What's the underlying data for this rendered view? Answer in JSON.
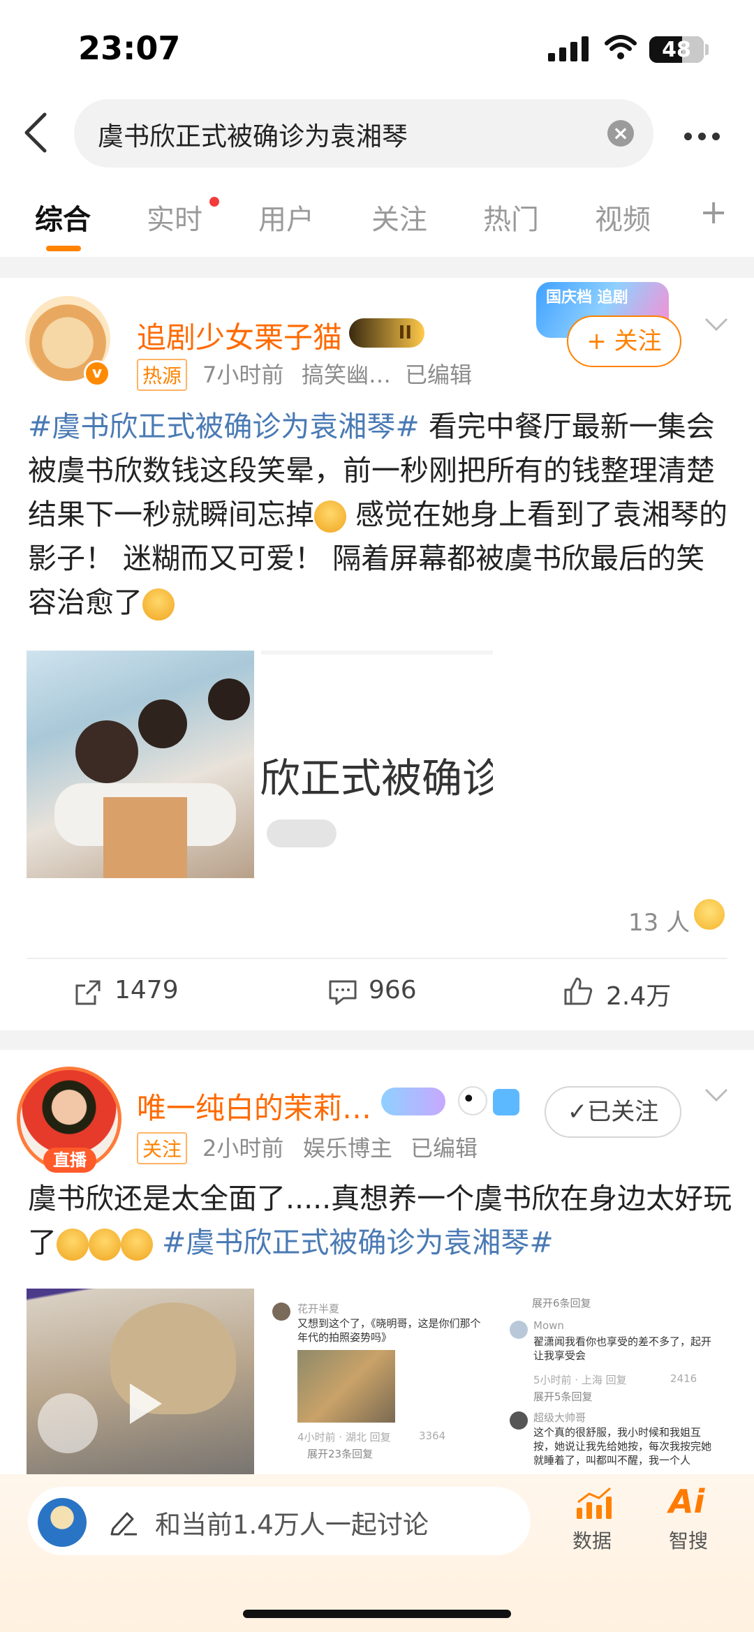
{
  "status": {
    "time": "23:07",
    "battery": "48"
  },
  "search": {
    "query": "虞书欣正式被确诊为袁湘琴"
  },
  "tabs": [
    {
      "label": "综合"
    },
    {
      "label": "实时"
    },
    {
      "label": "用户"
    },
    {
      "label": "关注"
    },
    {
      "label": "热门"
    },
    {
      "label": "视频"
    }
  ],
  "post1": {
    "username": "追剧少女栗子猫",
    "level_badge": "II",
    "tag": "热源",
    "time": "7小时前",
    "source": "搞笑幽…",
    "edited": "已编辑",
    "follow_label": "+ 关注",
    "promo_badge": "国庆档 追剧",
    "hashtag": "#虞书欣正式被确诊为袁湘琴#",
    "body": " 看完中餐厅最新一集会被虞书欣数钱这段笑晕，前一秒刚把所有的钱整理清楚结果下一秒就瞬间忘掉",
    "body2": " 感觉在她身上看到了袁湘琴的影子！ 迷糊而又可爱！ 隔着屏幕都被虞书欣最后的笑容治愈了",
    "image_caption": "欣正式被确诊",
    "reactions": "13 人",
    "repost_count": "1479",
    "comment_count": "966",
    "like_count": "2.4万"
  },
  "post2": {
    "username": "唯一纯白的茉莉…",
    "live_badge": "直播",
    "tag": "关注",
    "time": "2小时前",
    "source": "娱乐博主",
    "edited": "已编辑",
    "follow_label": "✓已关注",
    "body": "虞书欣还是太全面了.....真想养一个虞书欣在身边太好玩了",
    "hashtag": "#虞书欣正式被确诊为袁湘琴#",
    "comments_left": [
      {
        "user": "花开半夏",
        "text": "又想到这个了，《晓明哥，这是你们那个年代的拍照姿势吗》",
        "meta": "4小时前 · 湖北  回复",
        "likes": "3364",
        "expand": "展开23条回复"
      }
    ],
    "comments_right": [
      {
        "user": "Mown",
        "text": "翟潇闻我看你也享受的差不多了，起开让我享受会",
        "meta": "5小时前 · 上海  回复",
        "likes": "2416",
        "expand": "展开5条回复"
      },
      {
        "user": "超级大帅哥",
        "text": "这个真的很舒服，我小时候和我姐互按，她说让我先给她按，每次我按完她就睡着了，叫都叫不醒，我一个人",
        "meta": "",
        "likes": "",
        "expand": ""
      }
    ],
    "top_expand": "展开6条回复"
  },
  "bottom_bar": {
    "input_placeholder": "和当前1.4万人一起讨论",
    "data_label": "数据",
    "ai_label": "智搜"
  },
  "colors": {
    "accent": "#ff8200",
    "hashtag": "#4a7ab4",
    "username": "#ff6a00"
  }
}
